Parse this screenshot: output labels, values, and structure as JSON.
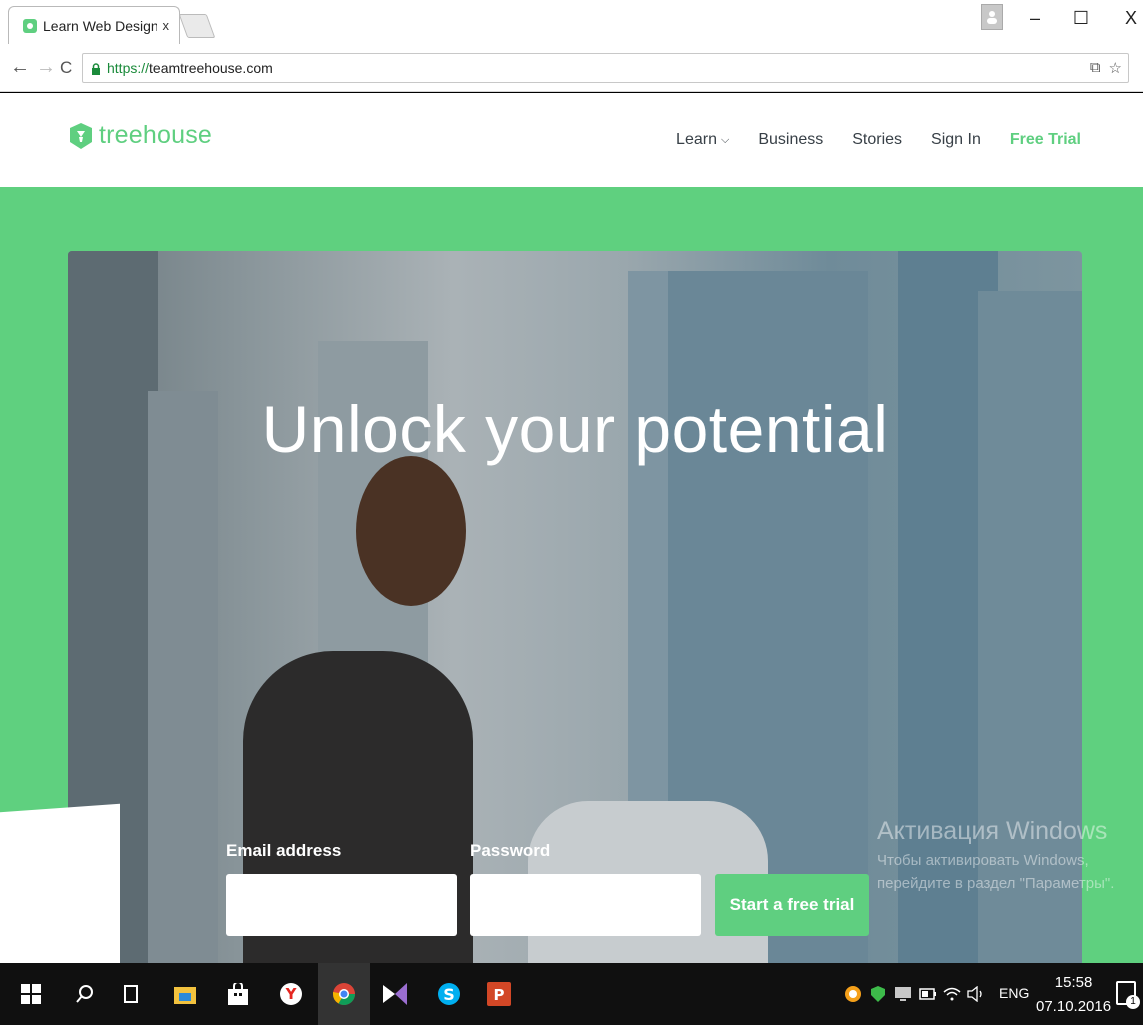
{
  "browser": {
    "tab_title": "Learn Web Design, W",
    "tab_close": "x",
    "url_scheme": "https://",
    "url_host": "teamtreehouse.com",
    "minimize": "–",
    "maximize": "☐",
    "close": "X",
    "back": "←",
    "forward": "→",
    "reload": "C",
    "translate_icon": "⧉",
    "star_icon": "☆"
  },
  "site": {
    "logo_text": "treehouse",
    "nav": [
      {
        "label": "Learn",
        "has_dropdown": true
      },
      {
        "label": "Business"
      },
      {
        "label": "Stories"
      },
      {
        "label": "Sign In"
      },
      {
        "label": "Free Trial"
      }
    ],
    "hero_title": "Unlock your potential",
    "form": {
      "email_label": "Email address",
      "email_value": "",
      "password_label": "Password",
      "password_value": "",
      "submit_label": "Start a free trial"
    }
  },
  "watermark": {
    "title": "Активация Windows",
    "line1": "Чтобы активировать Windows,",
    "line2": "перейдите в раздел \"Параметры\"."
  },
  "taskbar": {
    "lang": "ENG",
    "time": "15:58",
    "date": "07.10.2016",
    "notifications": "1"
  },
  "colors": {
    "brand_green": "#5fcf80",
    "page_green": "#5fd07f",
    "nav_text": "#384047"
  }
}
